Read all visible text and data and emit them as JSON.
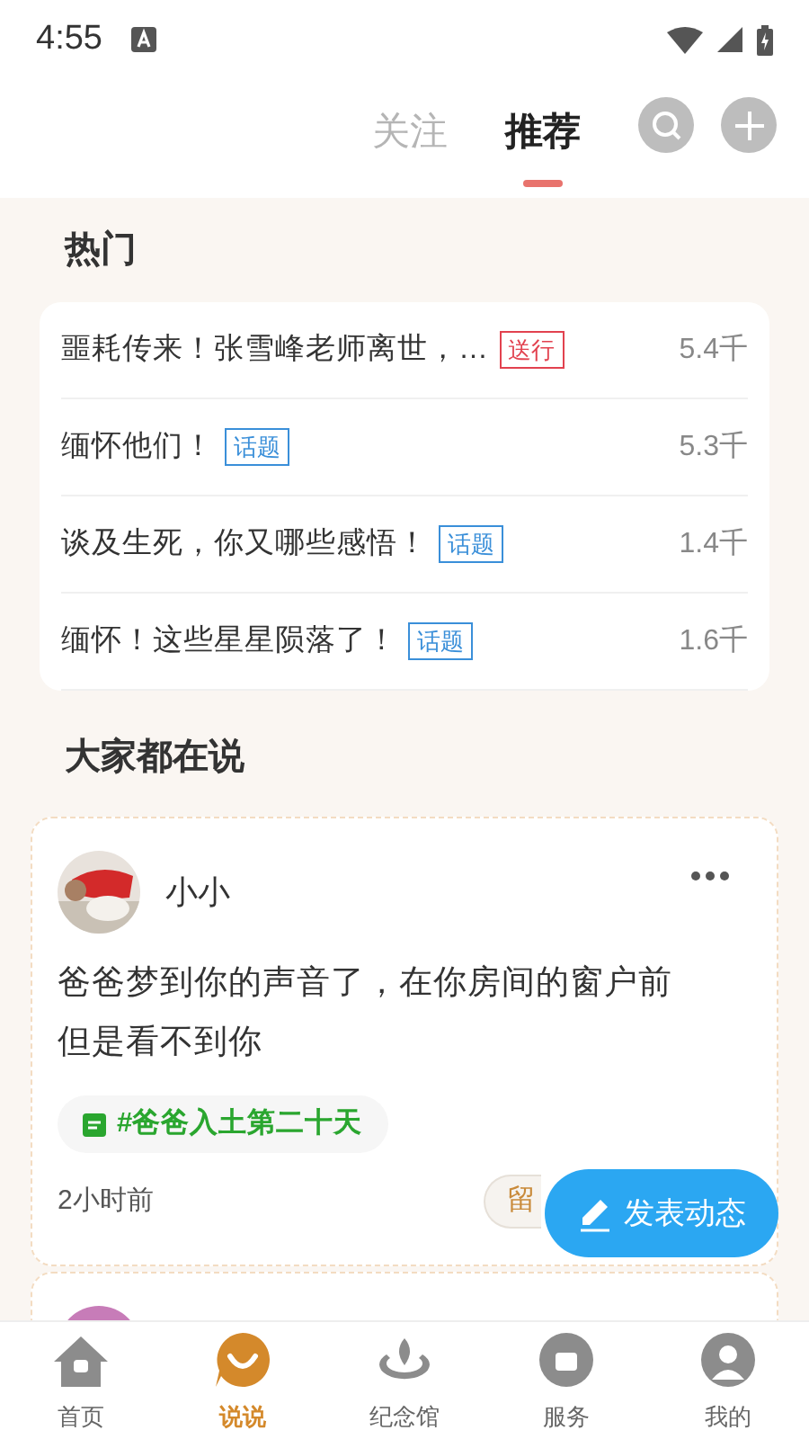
{
  "status_bar": {
    "time": "4:55"
  },
  "tabs": [
    {
      "label": "关注",
      "selected": false
    },
    {
      "label": "推荐",
      "selected": true
    }
  ],
  "hot": {
    "title": "热门",
    "items": [
      {
        "title": "噩耗传来！张雪峰老师离世，…",
        "tag": {
          "text": "送行",
          "kind": "farewell"
        },
        "count": "5.4千"
      },
      {
        "title": "缅怀他们！",
        "tag": {
          "text": "话题",
          "kind": "topic"
        },
        "count": "5.3千"
      },
      {
        "title": "谈及生死，你又哪些感悟！",
        "tag": {
          "text": "话题",
          "kind": "topic"
        },
        "count": "1.4千"
      },
      {
        "title": "缅怀！这些星星陨落了！",
        "tag": {
          "text": "话题",
          "kind": "topic"
        },
        "count": "1.6千"
      }
    ]
  },
  "feed": {
    "title": "大家都在说",
    "posts": [
      {
        "author": "小小",
        "text": "爸爸梦到你的声音了，在你房间的窗户前但是看不到你",
        "topic": "#爸爸入土第二十天",
        "time": "2小时前",
        "reply_button": "留"
      }
    ]
  },
  "fab": {
    "label": "发表动态"
  },
  "nav": [
    {
      "label": "首页",
      "kind": "home",
      "selected": false
    },
    {
      "label": "说说",
      "kind": "chat",
      "selected": true
    },
    {
      "label": "纪念馆",
      "kind": "memorial",
      "selected": false
    },
    {
      "label": "服务",
      "kind": "service",
      "selected": false
    },
    {
      "label": "我的",
      "kind": "me",
      "selected": false
    }
  ]
}
